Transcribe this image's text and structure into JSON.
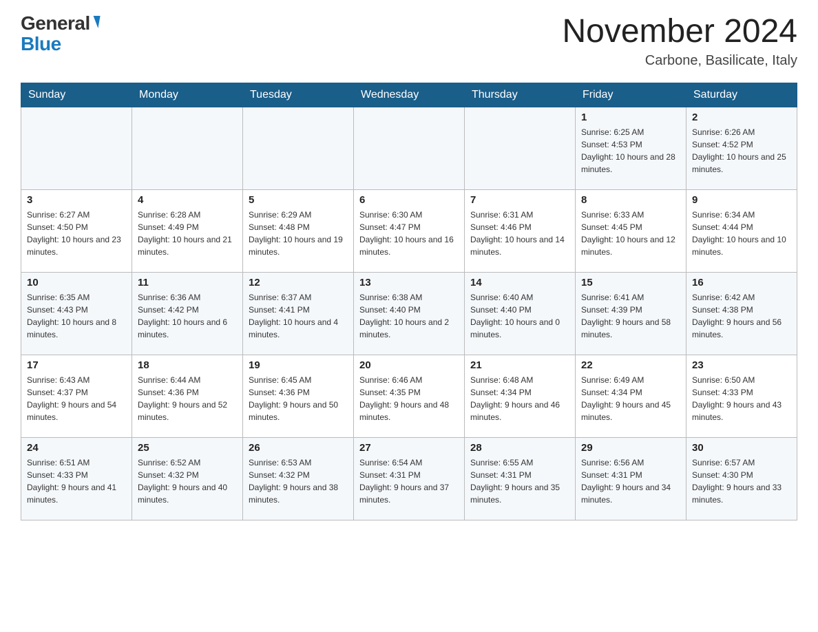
{
  "header": {
    "logo_general": "General",
    "logo_blue": "Blue",
    "month_title": "November 2024",
    "subtitle": "Carbone, Basilicate, Italy"
  },
  "days_of_week": [
    "Sunday",
    "Monday",
    "Tuesday",
    "Wednesday",
    "Thursday",
    "Friday",
    "Saturday"
  ],
  "weeks": [
    [
      {
        "day": "",
        "info": ""
      },
      {
        "day": "",
        "info": ""
      },
      {
        "day": "",
        "info": ""
      },
      {
        "day": "",
        "info": ""
      },
      {
        "day": "",
        "info": ""
      },
      {
        "day": "1",
        "info": "Sunrise: 6:25 AM\nSunset: 4:53 PM\nDaylight: 10 hours and 28 minutes."
      },
      {
        "day": "2",
        "info": "Sunrise: 6:26 AM\nSunset: 4:52 PM\nDaylight: 10 hours and 25 minutes."
      }
    ],
    [
      {
        "day": "3",
        "info": "Sunrise: 6:27 AM\nSunset: 4:50 PM\nDaylight: 10 hours and 23 minutes."
      },
      {
        "day": "4",
        "info": "Sunrise: 6:28 AM\nSunset: 4:49 PM\nDaylight: 10 hours and 21 minutes."
      },
      {
        "day": "5",
        "info": "Sunrise: 6:29 AM\nSunset: 4:48 PM\nDaylight: 10 hours and 19 minutes."
      },
      {
        "day": "6",
        "info": "Sunrise: 6:30 AM\nSunset: 4:47 PM\nDaylight: 10 hours and 16 minutes."
      },
      {
        "day": "7",
        "info": "Sunrise: 6:31 AM\nSunset: 4:46 PM\nDaylight: 10 hours and 14 minutes."
      },
      {
        "day": "8",
        "info": "Sunrise: 6:33 AM\nSunset: 4:45 PM\nDaylight: 10 hours and 12 minutes."
      },
      {
        "day": "9",
        "info": "Sunrise: 6:34 AM\nSunset: 4:44 PM\nDaylight: 10 hours and 10 minutes."
      }
    ],
    [
      {
        "day": "10",
        "info": "Sunrise: 6:35 AM\nSunset: 4:43 PM\nDaylight: 10 hours and 8 minutes."
      },
      {
        "day": "11",
        "info": "Sunrise: 6:36 AM\nSunset: 4:42 PM\nDaylight: 10 hours and 6 minutes."
      },
      {
        "day": "12",
        "info": "Sunrise: 6:37 AM\nSunset: 4:41 PM\nDaylight: 10 hours and 4 minutes."
      },
      {
        "day": "13",
        "info": "Sunrise: 6:38 AM\nSunset: 4:40 PM\nDaylight: 10 hours and 2 minutes."
      },
      {
        "day": "14",
        "info": "Sunrise: 6:40 AM\nSunset: 4:40 PM\nDaylight: 10 hours and 0 minutes."
      },
      {
        "day": "15",
        "info": "Sunrise: 6:41 AM\nSunset: 4:39 PM\nDaylight: 9 hours and 58 minutes."
      },
      {
        "day": "16",
        "info": "Sunrise: 6:42 AM\nSunset: 4:38 PM\nDaylight: 9 hours and 56 minutes."
      }
    ],
    [
      {
        "day": "17",
        "info": "Sunrise: 6:43 AM\nSunset: 4:37 PM\nDaylight: 9 hours and 54 minutes."
      },
      {
        "day": "18",
        "info": "Sunrise: 6:44 AM\nSunset: 4:36 PM\nDaylight: 9 hours and 52 minutes."
      },
      {
        "day": "19",
        "info": "Sunrise: 6:45 AM\nSunset: 4:36 PM\nDaylight: 9 hours and 50 minutes."
      },
      {
        "day": "20",
        "info": "Sunrise: 6:46 AM\nSunset: 4:35 PM\nDaylight: 9 hours and 48 minutes."
      },
      {
        "day": "21",
        "info": "Sunrise: 6:48 AM\nSunset: 4:34 PM\nDaylight: 9 hours and 46 minutes."
      },
      {
        "day": "22",
        "info": "Sunrise: 6:49 AM\nSunset: 4:34 PM\nDaylight: 9 hours and 45 minutes."
      },
      {
        "day": "23",
        "info": "Sunrise: 6:50 AM\nSunset: 4:33 PM\nDaylight: 9 hours and 43 minutes."
      }
    ],
    [
      {
        "day": "24",
        "info": "Sunrise: 6:51 AM\nSunset: 4:33 PM\nDaylight: 9 hours and 41 minutes."
      },
      {
        "day": "25",
        "info": "Sunrise: 6:52 AM\nSunset: 4:32 PM\nDaylight: 9 hours and 40 minutes."
      },
      {
        "day": "26",
        "info": "Sunrise: 6:53 AM\nSunset: 4:32 PM\nDaylight: 9 hours and 38 minutes."
      },
      {
        "day": "27",
        "info": "Sunrise: 6:54 AM\nSunset: 4:31 PM\nDaylight: 9 hours and 37 minutes."
      },
      {
        "day": "28",
        "info": "Sunrise: 6:55 AM\nSunset: 4:31 PM\nDaylight: 9 hours and 35 minutes."
      },
      {
        "day": "29",
        "info": "Sunrise: 6:56 AM\nSunset: 4:31 PM\nDaylight: 9 hours and 34 minutes."
      },
      {
        "day": "30",
        "info": "Sunrise: 6:57 AM\nSunset: 4:30 PM\nDaylight: 9 hours and 33 minutes."
      }
    ]
  ]
}
